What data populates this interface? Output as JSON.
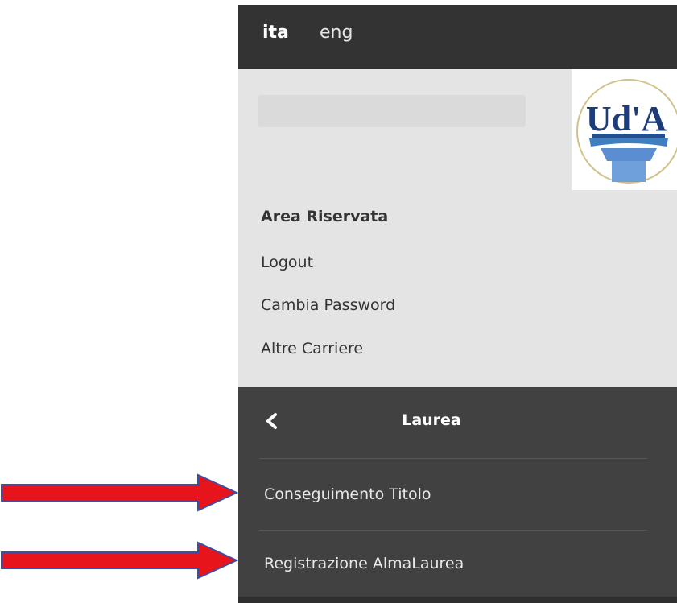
{
  "languages": {
    "ita": "ita",
    "eng": "eng"
  },
  "logo": {
    "text": "Ud'A"
  },
  "reserved_area": {
    "title": "Area Riservata",
    "links": [
      "Logout",
      "Cambia Password",
      "Altre Carriere"
    ]
  },
  "submenu": {
    "title": "Laurea",
    "items": [
      "Conseguimento Titolo",
      "Registrazione AlmaLaurea"
    ]
  },
  "colors": {
    "header_bg": "#333333",
    "submenu_bg": "#414141",
    "panel_bg": "#e4e4e4",
    "arrow_red": "#e8141b",
    "arrow_outline": "#3b4ea3"
  }
}
